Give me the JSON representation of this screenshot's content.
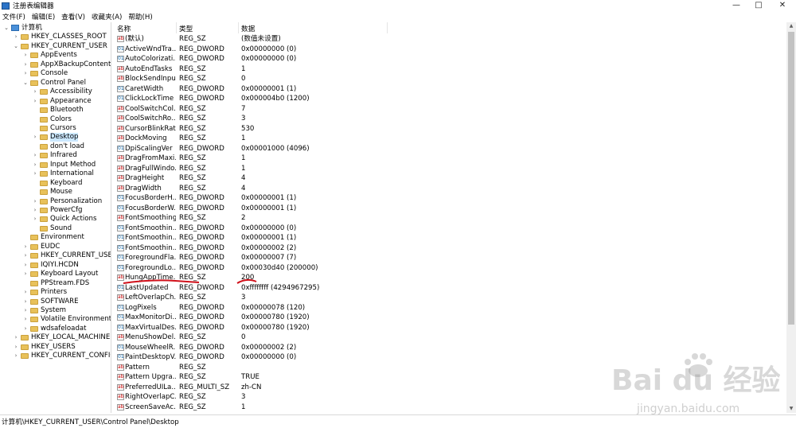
{
  "window": {
    "title": "注册表编辑器",
    "controls": [
      "—",
      "□",
      "✕"
    ]
  },
  "menu": [
    "文件(F)",
    "编辑(E)",
    "查看(V)",
    "收藏夹(A)",
    "帮助(H)"
  ],
  "tree": [
    {
      "label": "计算机",
      "expander": "⌄",
      "icon": "computer-icon"
    },
    {
      "label": "HKEY_CLASSES_ROOT",
      "expander": "›"
    },
    {
      "label": "HKEY_CURRENT_USER",
      "expander": "⌄"
    },
    {
      "label": "AppEvents",
      "expander": "›"
    },
    {
      "label": "AppXBackupContentTy",
      "expander": "›"
    },
    {
      "label": "Console",
      "expander": "›"
    },
    {
      "label": "Control Panel",
      "expander": "⌄"
    },
    {
      "label": "Accessibility",
      "expander": "›"
    },
    {
      "label": "Appearance",
      "expander": "›"
    },
    {
      "label": "Bluetooth",
      "expander": ""
    },
    {
      "label": "Colors",
      "expander": ""
    },
    {
      "label": "Cursors",
      "expander": ""
    },
    {
      "label": "Desktop",
      "expander": "›",
      "selected": true
    },
    {
      "label": "don't load",
      "expander": ""
    },
    {
      "label": "Infrared",
      "expander": "›"
    },
    {
      "label": "Input Method",
      "expander": "›"
    },
    {
      "label": "International",
      "expander": "›"
    },
    {
      "label": "Keyboard",
      "expander": ""
    },
    {
      "label": "Mouse",
      "expander": ""
    },
    {
      "label": "Personalization",
      "expander": "›"
    },
    {
      "label": "PowerCfg",
      "expander": "›"
    },
    {
      "label": "Quick Actions",
      "expander": "›"
    },
    {
      "label": "Sound",
      "expander": ""
    },
    {
      "label": "Environment",
      "expander": ""
    },
    {
      "label": "EUDC",
      "expander": "›"
    },
    {
      "label": "HKEY_CURRENT_USER",
      "expander": "›"
    },
    {
      "label": "IQIYI.HCDN",
      "expander": "›"
    },
    {
      "label": "Keyboard Layout",
      "expander": "›"
    },
    {
      "label": "PPStream.FDS",
      "expander": ""
    },
    {
      "label": "Printers",
      "expander": "›"
    },
    {
      "label": "SOFTWARE",
      "expander": "›"
    },
    {
      "label": "System",
      "expander": "›"
    },
    {
      "label": "Volatile Environment",
      "expander": "›"
    },
    {
      "label": "wdsafeloadat",
      "expander": "›"
    },
    {
      "label": "HKEY_LOCAL_MACHINE",
      "expander": "›"
    },
    {
      "label": "HKEY_USERS",
      "expander": "›"
    },
    {
      "label": "HKEY_CURRENT_CONFIG",
      "expander": "›"
    }
  ],
  "columns": {
    "name": "名称",
    "type": "类型",
    "data": "数据"
  },
  "rows": [
    {
      "name": "(默认)",
      "type": "REG_SZ",
      "data": "(数值未设置)"
    },
    {
      "name": "ActiveWndTra...",
      "type": "REG_DWORD",
      "data": "0x00000000 (0)"
    },
    {
      "name": "AutoColorizati...",
      "type": "REG_DWORD",
      "data": "0x00000000 (0)"
    },
    {
      "name": "AutoEndTasks",
      "type": "REG_SZ",
      "data": "1"
    },
    {
      "name": "BlockSendInpu...",
      "type": "REG_SZ",
      "data": "0"
    },
    {
      "name": "CaretWidth",
      "type": "REG_DWORD",
      "data": "0x00000001 (1)"
    },
    {
      "name": "ClickLockTime",
      "type": "REG_DWORD",
      "data": "0x000004b0 (1200)"
    },
    {
      "name": "CoolSwitchCol...",
      "type": "REG_SZ",
      "data": "7"
    },
    {
      "name": "CoolSwitchRo...",
      "type": "REG_SZ",
      "data": "3"
    },
    {
      "name": "CursorBlinkRate",
      "type": "REG_SZ",
      "data": "530"
    },
    {
      "name": "DockMoving",
      "type": "REG_SZ",
      "data": "1"
    },
    {
      "name": "DpiScalingVer",
      "type": "REG_DWORD",
      "data": "0x00001000 (4096)"
    },
    {
      "name": "DragFromMaxi...",
      "type": "REG_SZ",
      "data": "1"
    },
    {
      "name": "DragFullWindo...",
      "type": "REG_SZ",
      "data": "1"
    },
    {
      "name": "DragHeight",
      "type": "REG_SZ",
      "data": "4"
    },
    {
      "name": "DragWidth",
      "type": "REG_SZ",
      "data": "4"
    },
    {
      "name": "FocusBorderH...",
      "type": "REG_DWORD",
      "data": "0x00000001 (1)"
    },
    {
      "name": "FocusBorderW...",
      "type": "REG_DWORD",
      "data": "0x00000001 (1)"
    },
    {
      "name": "FontSmoothing",
      "type": "REG_SZ",
      "data": "2"
    },
    {
      "name": "FontSmoothin...",
      "type": "REG_DWORD",
      "data": "0x00000000 (0)"
    },
    {
      "name": "FontSmoothin...",
      "type": "REG_DWORD",
      "data": "0x00000001 (1)"
    },
    {
      "name": "FontSmoothin...",
      "type": "REG_DWORD",
      "data": "0x00000002 (2)"
    },
    {
      "name": "ForegroundFla...",
      "type": "REG_DWORD",
      "data": "0x00000007 (7)"
    },
    {
      "name": "ForegroundLo...",
      "type": "REG_DWORD",
      "data": "0x00030d40 (200000)"
    },
    {
      "name": "HungAppTime...",
      "type": "REG_SZ",
      "data": "200"
    },
    {
      "name": "LastUpdated",
      "type": "REG_DWORD",
      "data": "0xffffffff (4294967295)"
    },
    {
      "name": "LeftOverlapCh...",
      "type": "REG_SZ",
      "data": "3"
    },
    {
      "name": "LogPixels",
      "type": "REG_DWORD",
      "data": "0x00000078 (120)"
    },
    {
      "name": "MaxMonitorDi...",
      "type": "REG_DWORD",
      "data": "0x00000780 (1920)"
    },
    {
      "name": "MaxVirtualDes...",
      "type": "REG_DWORD",
      "data": "0x00000780 (1920)"
    },
    {
      "name": "MenuShowDel...",
      "type": "REG_SZ",
      "data": "0"
    },
    {
      "name": "MouseWheelR...",
      "type": "REG_DWORD",
      "data": "0x00000002 (2)"
    },
    {
      "name": "PaintDesktopV...",
      "type": "REG_DWORD",
      "data": "0x00000000 (0)"
    },
    {
      "name": "Pattern",
      "type": "REG_SZ",
      "data": ""
    },
    {
      "name": "Pattern Upgra...",
      "type": "REG_SZ",
      "data": "TRUE"
    },
    {
      "name": "PreferredUILa...",
      "type": "REG_MULTI_SZ",
      "data": "zh-CN"
    },
    {
      "name": "RightOverlapC...",
      "type": "REG_SZ",
      "data": "3"
    },
    {
      "name": "ScreenSaveAc...",
      "type": "REG_SZ",
      "data": "1"
    }
  ],
  "status": "计算机\\HKEY_CURRENT_USER\\Control Panel\\Desktop",
  "watermark": {
    "brand": "Bai du 经验",
    "url": "jingyan.baidu.com"
  },
  "annotation_color": "#d0101a"
}
